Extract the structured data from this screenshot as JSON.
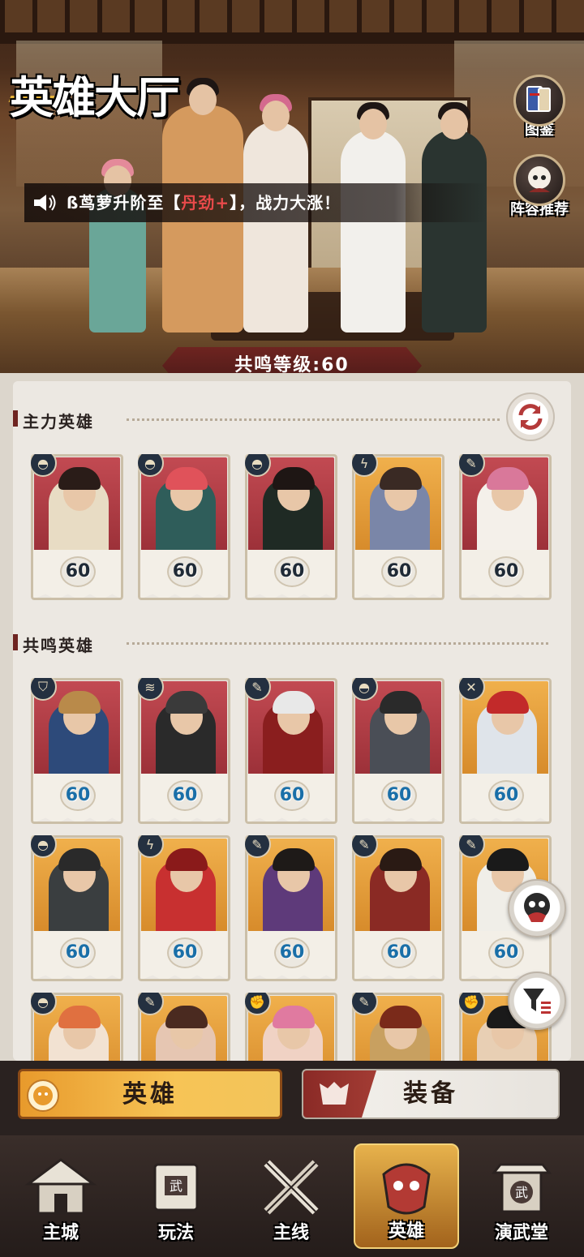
{
  "header": {
    "logo_text": "英雄大厅",
    "side_buttons": [
      {
        "name": "catalog",
        "label": "图鉴",
        "icon": "book-cards-icon"
      },
      {
        "name": "lineup",
        "label": "阵容推荐",
        "icon": "character-avatar-icon"
      }
    ],
    "marquee": {
      "prefix": "ß茑萝升阶至【",
      "highlight": "丹劲+",
      "suffix": "】，战力大涨！"
    },
    "resonance_level": "共鸣等级:60"
  },
  "main_heroes": {
    "title": "主力英雄",
    "cards": [
      {
        "level": "60",
        "bg": "red",
        "role": "assassin-hood-icon",
        "hair": "#2a1c18",
        "outfit": "#e8dcc4"
      },
      {
        "level": "60",
        "bg": "red",
        "role": "assassin-hood-icon",
        "hair": "#e0525a",
        "outfit": "#2f5d5a"
      },
      {
        "level": "60",
        "bg": "red",
        "role": "assassin-hood-icon",
        "hair": "#1e1614",
        "outfit": "#1f2a24"
      },
      {
        "level": "60",
        "bg": "gold",
        "role": "lightning-icon",
        "hair": "#3a2a24",
        "outfit": "#7a86a8"
      },
      {
        "level": "60",
        "bg": "red",
        "role": "feather-icon",
        "hair": "#d9789a",
        "outfit": "#f4f0ea"
      }
    ]
  },
  "resonance_heroes": {
    "title": "共鸣英雄",
    "cards": [
      {
        "level": "60",
        "bg": "red",
        "role": "shield-icon",
        "hair": "#b98a4a",
        "outfit": "#2d4a7a"
      },
      {
        "level": "60",
        "bg": "red",
        "role": "claw-icon",
        "hair": "#3a3a3a",
        "outfit": "#2a2a2a"
      },
      {
        "level": "60",
        "bg": "red",
        "role": "feather-icon",
        "hair": "#e8e8e8",
        "outfit": "#8a1e1e"
      },
      {
        "level": "60",
        "bg": "red",
        "role": "assassin-hood-icon",
        "hair": "#2a2a2a",
        "outfit": "#4a4e56"
      },
      {
        "level": "60",
        "bg": "gold",
        "role": "sword-icon",
        "hair": "#c22a2a",
        "outfit": "#dfe4ea"
      },
      {
        "level": "60",
        "bg": "gold",
        "role": "assassin-hood-icon",
        "hair": "#2a2a2a",
        "outfit": "#3a3e40"
      },
      {
        "level": "60",
        "bg": "gold",
        "role": "lightning-icon",
        "hair": "#8a1a1a",
        "outfit": "#c83030"
      },
      {
        "level": "60",
        "bg": "gold",
        "role": "feather-icon",
        "hair": "#1e1a18",
        "outfit": "#5e3a7a"
      },
      {
        "level": "60",
        "bg": "gold",
        "role": "feather-icon",
        "hair": "#2a1a14",
        "outfit": "#8a2a24"
      },
      {
        "level": "60",
        "bg": "gold",
        "role": "feather-icon",
        "hair": "#1a1a1a",
        "outfit": "#f0eee8"
      },
      {
        "level": "",
        "bg": "gold",
        "role": "assassin-hood-icon",
        "hair": "#e07040",
        "outfit": "#f2e2d2"
      },
      {
        "level": "",
        "bg": "gold",
        "role": "feather-icon",
        "hair": "#4a2a20",
        "outfit": "#e6c6b2"
      },
      {
        "level": "",
        "bg": "gold",
        "role": "fist-icon",
        "hair": "#e07aa0",
        "outfit": "#f0d2c4"
      },
      {
        "level": "",
        "bg": "gold",
        "role": "feather-icon",
        "hair": "#7a2a1a",
        "outfit": "#c8a060"
      },
      {
        "level": "",
        "bg": "gold",
        "role": "fist-icon",
        "hair": "#1a1a1a",
        "outfit": "#e8cfb4"
      }
    ]
  },
  "float_buttons": [
    {
      "name": "mask-avatar",
      "icon": "mask-face-icon"
    },
    {
      "name": "filter",
      "icon": "filter-icon"
    }
  ],
  "sub_tabs": [
    {
      "label": "英雄",
      "active": true,
      "icon": "hero-face-icon"
    },
    {
      "label": "装备",
      "active": false,
      "icon": "armor-icon"
    }
  ],
  "bottom_nav": [
    {
      "label": "主城",
      "icon": "castle-icon",
      "active": false
    },
    {
      "label": "玩法",
      "icon": "scroll-icon",
      "active": false
    },
    {
      "label": "主线",
      "icon": "crossed-swords-icon",
      "active": false
    },
    {
      "label": "英雄",
      "icon": "hero-mask-icon",
      "active": true
    },
    {
      "label": "演武堂",
      "icon": "martial-hall-icon",
      "active": false
    }
  ],
  "colors": {
    "accent_red": "#6e2420",
    "card_red": "#c24a52",
    "card_gold": "#f0b04c",
    "highlight_text": "#e84a4a",
    "tab_active": "#f7c456"
  }
}
